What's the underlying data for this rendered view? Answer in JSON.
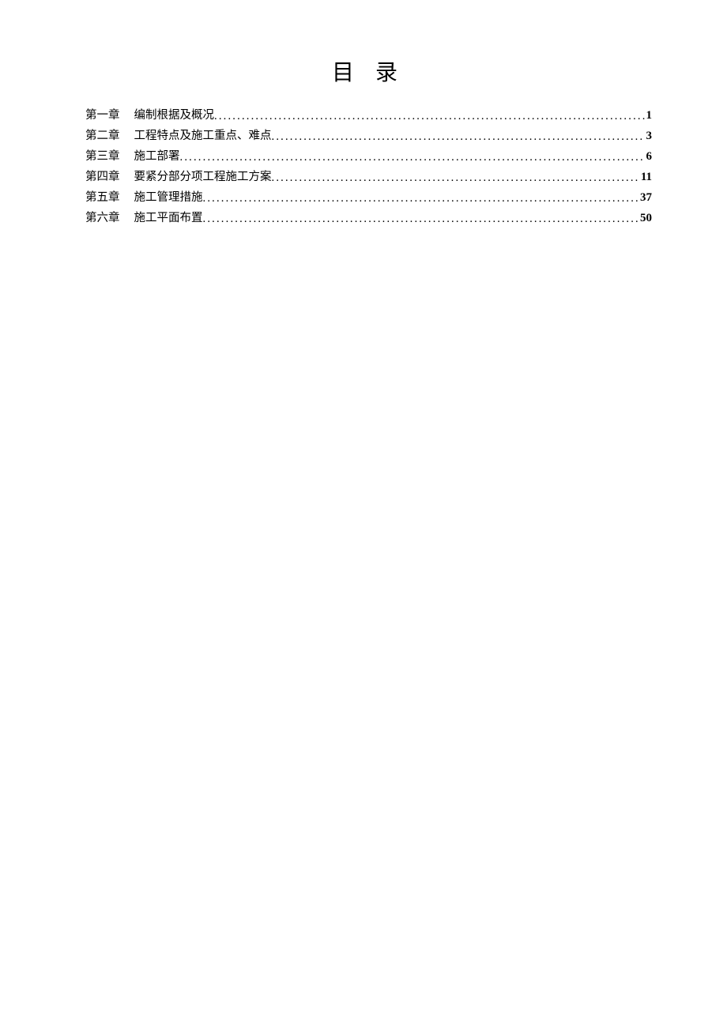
{
  "title": "目 录",
  "toc": [
    {
      "chapter": "第一章",
      "entry": "编制根据及概况",
      "page": "1"
    },
    {
      "chapter": "第二章",
      "entry": "工程特点及施工重点、难点",
      "page": "3"
    },
    {
      "chapter": "第三章",
      "entry": "施工部署",
      "page": "6"
    },
    {
      "chapter": "第四章",
      "entry": "要紧分部分项工程施工方案",
      "page": "11"
    },
    {
      "chapter": "第五章",
      "entry": "施工管理措施",
      "page": "37"
    },
    {
      "chapter": "第六章",
      "entry": "施工平面布置",
      "page": "50"
    }
  ]
}
